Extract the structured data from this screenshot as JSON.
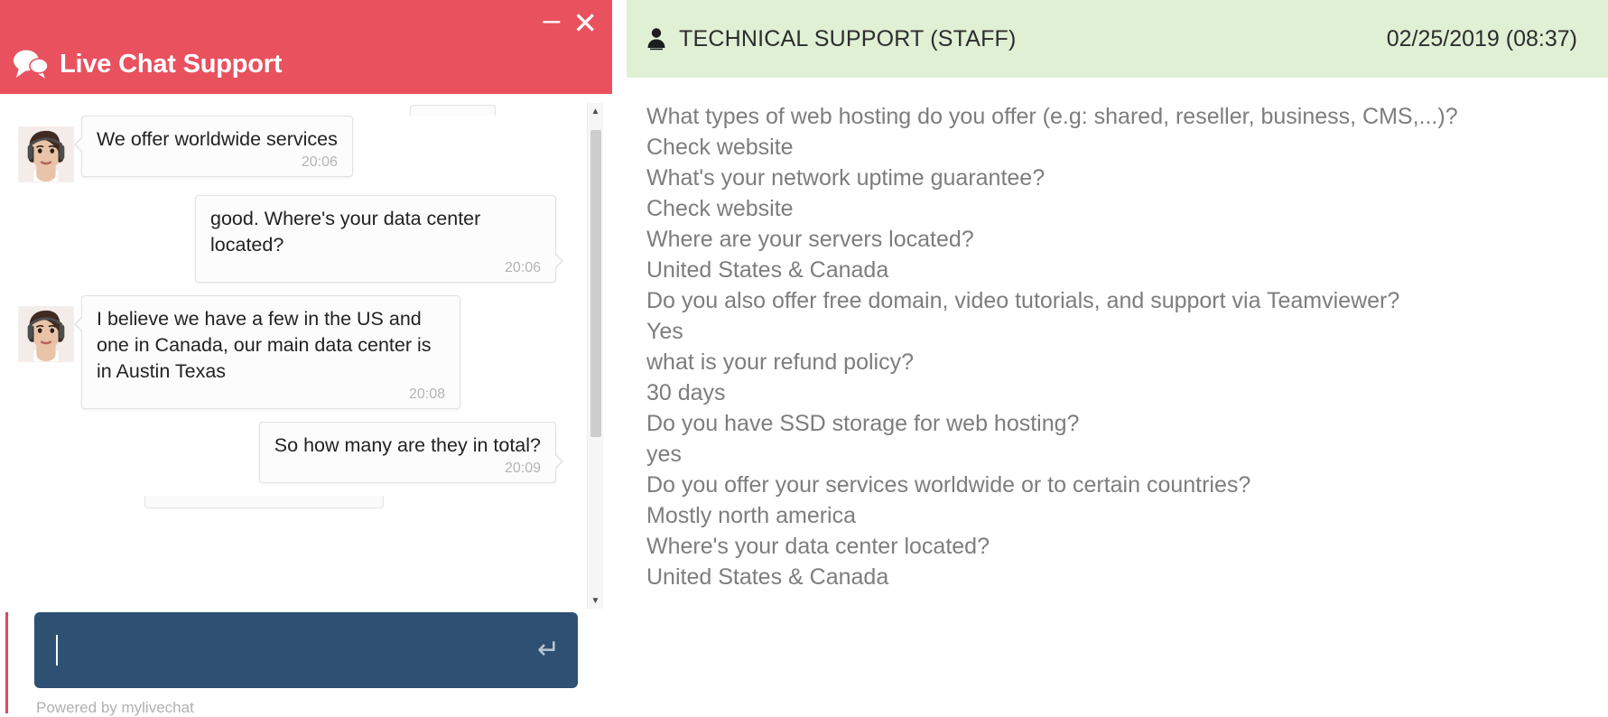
{
  "chat_widget": {
    "header": {
      "title": "Live Chat Support",
      "icon": "chat-bubble-icon",
      "minimize_label": "–",
      "close_label": "✕",
      "background_color": "#e9515f"
    },
    "messages": [
      {
        "sender": "agent",
        "text": "We offer worldwide services",
        "time": "20:06"
      },
      {
        "sender": "visitor",
        "text": "good. Where's your data center located?",
        "time": "20:06"
      },
      {
        "sender": "agent",
        "text": "I believe we have a few in the US and one in Canada, our main data center is in Austin Texas",
        "time": "20:08"
      },
      {
        "sender": "visitor",
        "text": "So how many are they in total?",
        "time": "20:09"
      }
    ],
    "composer": {
      "value": "",
      "placeholder": "",
      "send_icon": "↵",
      "background_color": "#2d5073"
    },
    "footer": {
      "powered_by": "Powered by mylivechat"
    },
    "scrollbar": {
      "up_arrow": "▲",
      "down_arrow": "▼"
    }
  },
  "transcript": {
    "header": {
      "icon": "person-icon",
      "staff_name": "TECHNICAL SUPPORT (STAFF)",
      "timestamp": "02/25/2019 (08:37)",
      "background_color": "#dff0d5"
    },
    "lines": [
      "What types of web hosting do you offer (e.g: shared, reseller, business, CMS,...)?",
      "Check website",
      "What's your network uptime guarantee?",
      "Check website",
      "Where are your servers located?",
      "United States & Canada",
      "Do you also offer free domain, video tutorials, and support via Teamviewer?",
      "Yes",
      "what is your refund policy?",
      "30 days",
      "Do you have SSD storage for web hosting?",
      "yes",
      "Do you offer your services worldwide or to certain countries?",
      "Mostly north america",
      "Where's your data center located?",
      "United States & Canada"
    ]
  }
}
